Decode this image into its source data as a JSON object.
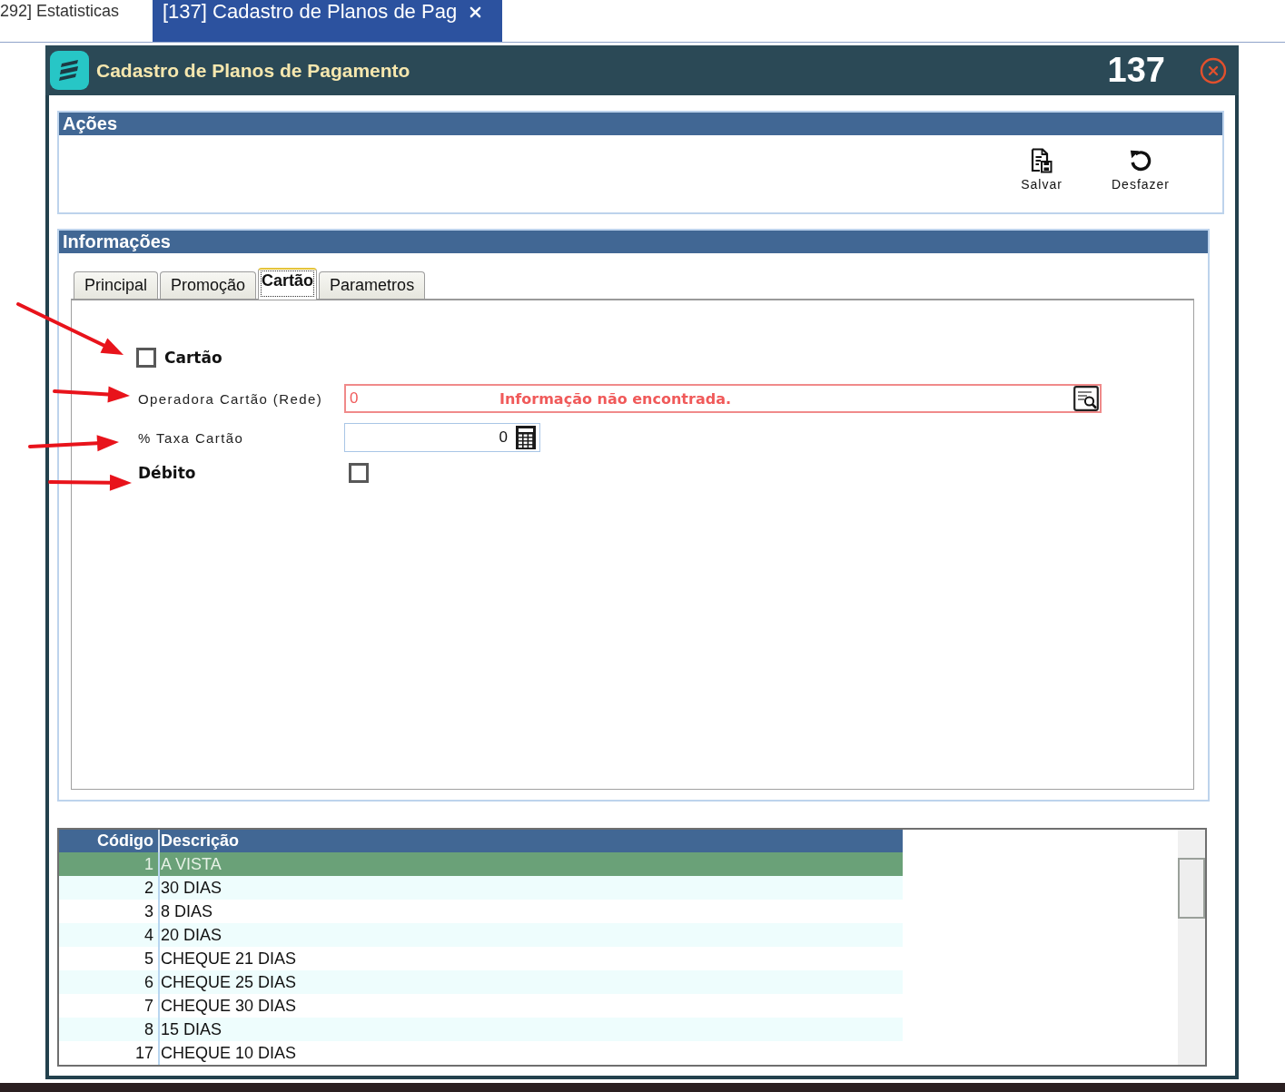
{
  "tabs": [
    {
      "label": "292] Estatisticas",
      "selected": false,
      "closable": false
    },
    {
      "label": "[137] Cadastro de Planos de Pag",
      "selected": true,
      "closable": true
    }
  ],
  "window": {
    "title": "Cadastro de Planos de Pagamento",
    "record_number": "137"
  },
  "actions": {
    "title": "Ações",
    "buttons": [
      {
        "label": "Salvar",
        "kind": "save"
      },
      {
        "label": "Desfazer",
        "kind": "undo"
      }
    ]
  },
  "info": {
    "title": "Informações",
    "tabs": [
      {
        "label": "Principal",
        "selected": false
      },
      {
        "label": "Promoção",
        "selected": false
      },
      {
        "label": "Cartão",
        "selected": true
      },
      {
        "label": "Parametros",
        "selected": false
      }
    ],
    "fields": [
      {
        "kind": "checkbox",
        "label": "Cartão",
        "checked": false,
        "annotated": true
      },
      {
        "kind": "lookup",
        "label": "Operadora Cartão (Rede)",
        "value": "0",
        "message": "Informação não encontrada.",
        "error": true,
        "annotated": true
      },
      {
        "kind": "number",
        "label": "% Taxa Cartão",
        "value": "0",
        "annotated": true
      },
      {
        "kind": "check_field",
        "label": "Débito",
        "checked": false,
        "annotated": true
      }
    ]
  },
  "table": {
    "columns": [
      "Código",
      "Descrição"
    ],
    "rows": [
      {
        "cells": [
          "1",
          "A VISTA"
        ],
        "selected": true
      },
      {
        "cells": [
          "2",
          "30 DIAS"
        ],
        "selected": false
      },
      {
        "cells": [
          "3",
          "8 DIAS"
        ],
        "selected": false
      },
      {
        "cells": [
          "4",
          "20 DIAS"
        ],
        "selected": false
      },
      {
        "cells": [
          "5",
          "CHEQUE 21 DIAS"
        ],
        "selected": false
      },
      {
        "cells": [
          "6",
          "CHEQUE 25 DIAS"
        ],
        "selected": false
      },
      {
        "cells": [
          "7",
          "CHEQUE 30 DIAS"
        ],
        "selected": false
      },
      {
        "cells": [
          "8",
          "15 DIAS"
        ],
        "selected": false
      },
      {
        "cells": [
          "17",
          "CHEQUE 10 DIAS"
        ],
        "selected": false
      }
    ]
  }
}
